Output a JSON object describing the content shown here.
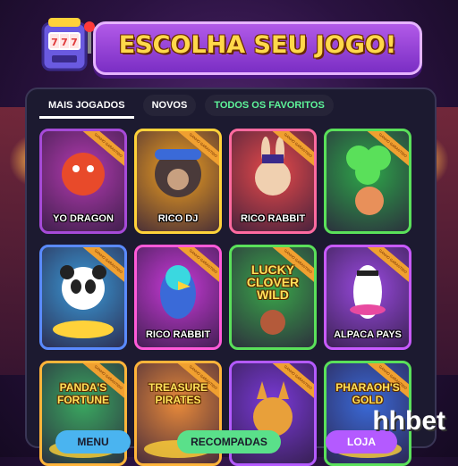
{
  "header": {
    "title": "ESCOLHA SEU JOGO!"
  },
  "tabs": [
    {
      "label": "MAIS JOGADOS",
      "active": true
    },
    {
      "label": "NOVOS",
      "active": false
    },
    {
      "label": "TODOS OS FAVORITOS",
      "active": false
    }
  ],
  "games": [
    {
      "label": "YO DRAGON",
      "border": "#a64ad8",
      "bg": "#b33ab0"
    },
    {
      "label": "RICO DJ",
      "border": "#ffd23a",
      "bg": "#f0a020"
    },
    {
      "label": "RICO RABBIT",
      "border": "#ff6aa0",
      "bg": "#e84a4a"
    },
    {
      "label": "",
      "border": "#5ae05a",
      "bg": "#2ea84a"
    },
    {
      "label": "",
      "border": "#5a8aff",
      "bg": "#3a9ad8"
    },
    {
      "label": "RICO RABBIT",
      "border": "#ff5ad8",
      "bg": "#c83ad8"
    },
    {
      "label": "LUCKY CLOVER WILD",
      "border": "#5ae05a",
      "bg": "#3aa84a"
    },
    {
      "label": "ALPACA PAYS",
      "border": "#c85aff",
      "bg": "#9a4ae0"
    },
    {
      "label": "PANDA'S FORTUNE",
      "border": "#ffb43a",
      "bg": "#3aa860"
    },
    {
      "label": "TREASURE PIRATES",
      "border": "#ffb43a",
      "bg": "#e88a3a"
    },
    {
      "label": "",
      "border": "#b45aff",
      "bg": "#7a3ad8"
    },
    {
      "label": "PHARAOH'S GOLD",
      "border": "#5ae05a",
      "bg": "#3a6ad8"
    }
  ],
  "ribbon_text": "GANHO GARANTIDO",
  "bottom_nav": [
    {
      "label": "MENU",
      "color": "#4ab4f0"
    },
    {
      "label": "RECOMPADAS",
      "color": "#5ae08a"
    },
    {
      "label": "LOJA",
      "color": "#b45aff"
    }
  ],
  "brand": "hhbet"
}
